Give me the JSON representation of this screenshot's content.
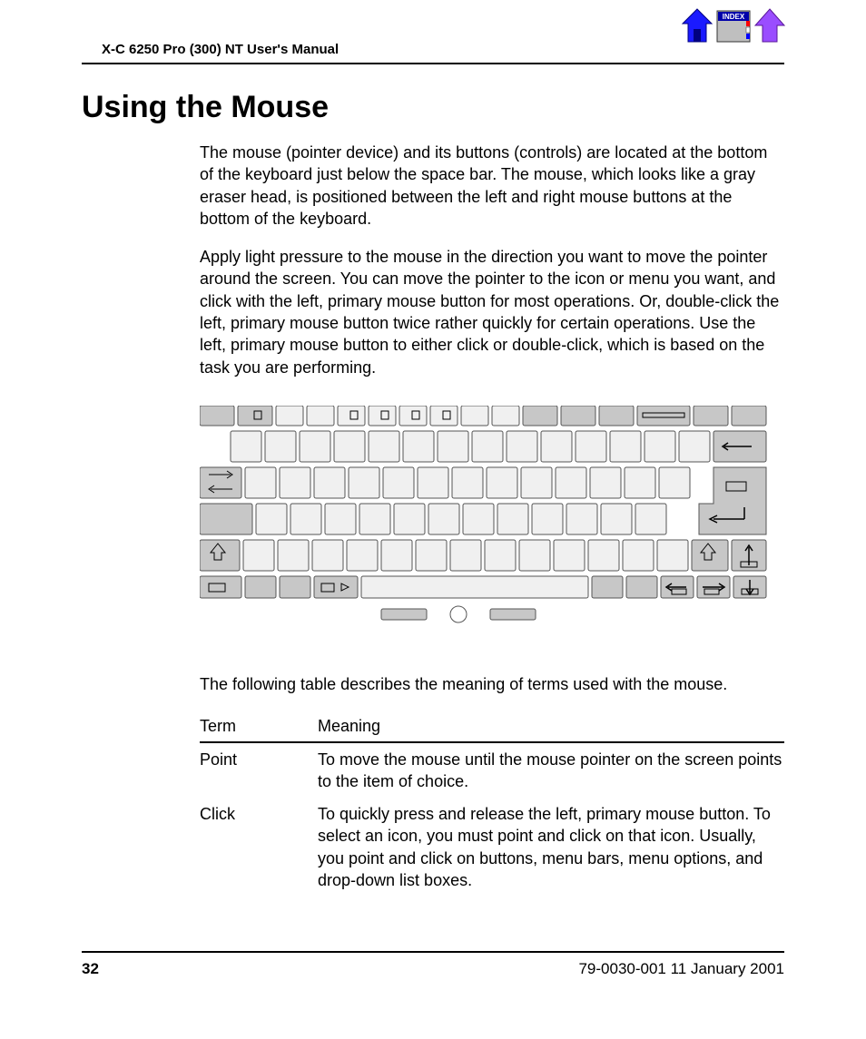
{
  "header": {
    "running_head": "X-C 6250 Pro (300) NT User's Manual"
  },
  "nav": {
    "home_label": "Home",
    "index_label": "INDEX",
    "up_label": "Up"
  },
  "section": {
    "title": "Using the Mouse",
    "para1": "The mouse (pointer device) and its buttons (controls) are located at the bottom of the keyboard just below the space bar. The mouse, which looks like a gray eraser head, is positioned between the left and right mouse buttons at the bottom of the keyboard.",
    "para2": "Apply light pressure to the mouse in the direction you want to move the pointer around the screen. You can move the pointer to the icon or menu you want, and click with the left, primary mouse button for most operations. Or, double-click the left, primary mouse button twice rather quickly for certain operations. Use the left, primary mouse button to either click or double-click, which is based on the task you are performing.",
    "table_intro": "The following table describes the meaning of terms used with the mouse."
  },
  "table": {
    "head_term": "Term",
    "head_meaning": "Meaning",
    "rows": [
      {
        "term": "Point",
        "meaning": "To move the mouse until the mouse pointer on the screen points to the item of choice."
      },
      {
        "term": "Click",
        "meaning": "To quickly press and release the left, primary mouse button. To select an icon, you must point and click on that icon. Usually, you point and click on buttons, menu bars, menu options, and drop-down list boxes."
      }
    ]
  },
  "footer": {
    "page_number": "32",
    "doc_id": "79-0030-001   11 January 2001"
  }
}
